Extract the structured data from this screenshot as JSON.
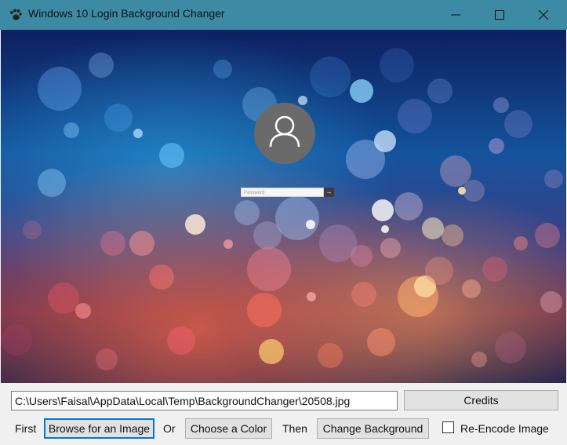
{
  "window": {
    "title": "Windows 10 Login Background Changer",
    "accent_color": "#3d8aa5"
  },
  "preview": {
    "password_placeholder": "Password",
    "submit_arrow": "→"
  },
  "controls": {
    "path_value": "C:\\Users\\Faisal\\AppData\\Local\\Temp\\BackgroundChanger\\20508.jpg",
    "credits_label": "Credits",
    "first_label": "First",
    "browse_label": "Browse for an Image",
    "or_label": "Or",
    "color_label": "Choose a Color",
    "then_label": "Then",
    "change_label": "Change Background",
    "reencode_label": "Re-Encode Image",
    "reencode_checked": false
  }
}
